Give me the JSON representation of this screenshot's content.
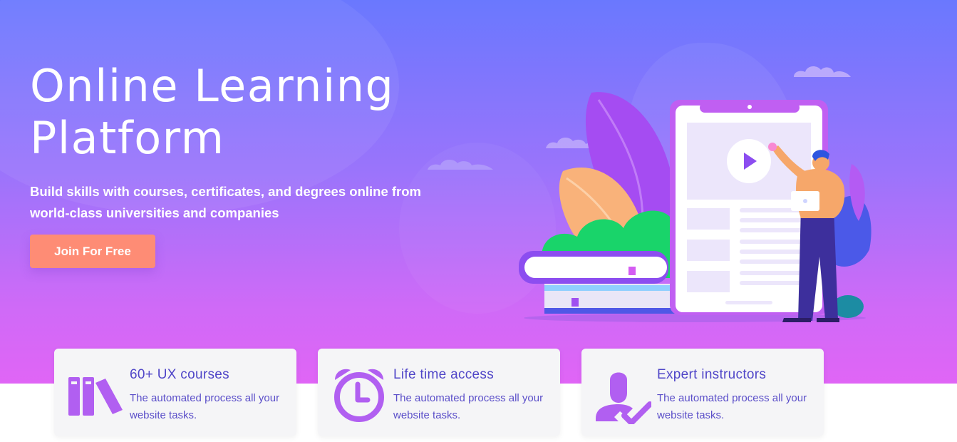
{
  "hero": {
    "title_line1": "Online Learning",
    "title_line2": "Platform",
    "subtitle_line1": "Build skills with courses, certificates, and degrees online from",
    "subtitle_line2": "world-class universities and companies",
    "cta_label": "Join For Free"
  },
  "features": [
    {
      "title": "60+ UX courses",
      "desc_line1": "The automated process all your",
      "desc_line2": "website tasks.",
      "icon": "books-icon"
    },
    {
      "title": "Life time access",
      "desc_line1": "The automated process all your",
      "desc_line2": "website tasks.",
      "icon": "alarm-clock-icon"
    },
    {
      "title": "Expert instructors",
      "desc_line1": "The automated process all your",
      "desc_line2": "website tasks.",
      "icon": "instructor-check-icon"
    }
  ],
  "colors": {
    "gradient_top": "#6a78fe",
    "gradient_bottom": "#e065f6",
    "cta": "#fe8c75",
    "icon": "#b15ff1",
    "card_title": "#5046c8",
    "card_bg": "#f5f5f7"
  }
}
